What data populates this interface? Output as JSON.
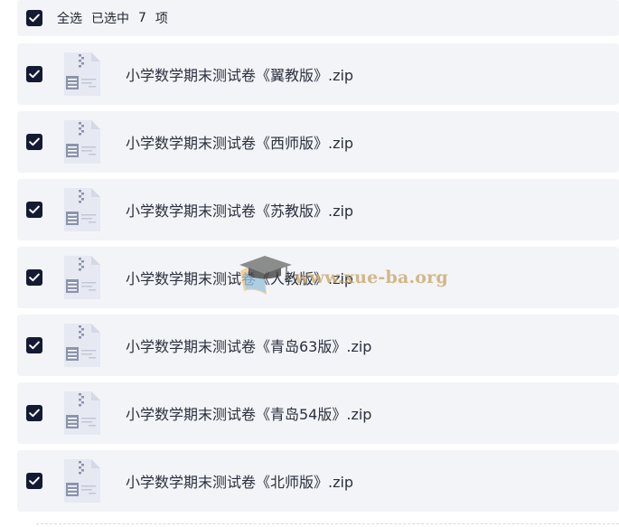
{
  "header": {
    "select_all_label": "全选",
    "selected_prefix": "已选中",
    "selected_count": "7",
    "selected_suffix": "项",
    "checked": true
  },
  "files": [
    {
      "name": "小学数学期末测试卷《翼教版》.zip",
      "checked": true,
      "icon": "zip-file-icon"
    },
    {
      "name": "小学数学期末测试卷《西师版》.zip",
      "checked": true,
      "icon": "zip-file-icon"
    },
    {
      "name": "小学数学期末测试卷《苏教版》.zip",
      "checked": true,
      "icon": "zip-file-icon"
    },
    {
      "name": "小学数学期末测试卷《人教版》.zip",
      "checked": true,
      "icon": "zip-file-icon"
    },
    {
      "name": "小学数学期末测试卷《青岛63版》.zip",
      "checked": true,
      "icon": "zip-file-icon"
    },
    {
      "name": "小学数学期末测试卷《青岛54版》.zip",
      "checked": true,
      "icon": "zip-file-icon"
    },
    {
      "name": "小学数学期末测试卷《北师版》.zip",
      "checked": true,
      "icon": "zip-file-icon"
    }
  ],
  "watermark": {
    "text": "www.xue-ba.org",
    "icon": "graduation-cap-icon"
  },
  "colors": {
    "checkbox_fill": "#141a33",
    "row_background": "#f3f4f7",
    "text": "#2a2f3d",
    "watermark": "#caa66a"
  }
}
